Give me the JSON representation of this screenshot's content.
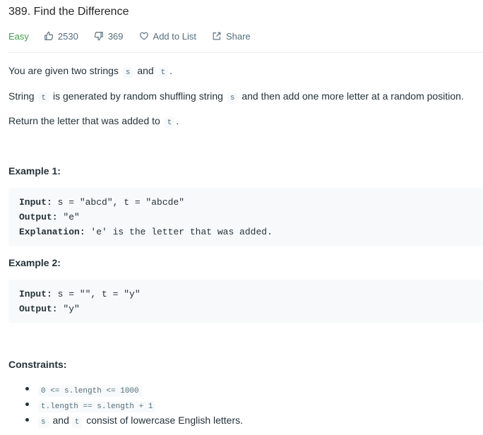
{
  "problem": {
    "title": "389. Find the Difference",
    "difficulty": "Easy",
    "likes": "2530",
    "dislikes": "369",
    "add_to_list": "Add to List",
    "share": "Share"
  },
  "description": {
    "p1": {
      "a": "You are given two strings",
      "s": "s",
      "b": "and",
      "t": "t",
      "c": "."
    },
    "p2": {
      "a": "String",
      "t": "t",
      "b": "is generated by random shuffling string",
      "s": "s",
      "c": "and then add one more letter at a random position."
    },
    "p3": {
      "a": "Return the letter that was added to",
      "t": "t",
      "c": "."
    }
  },
  "examples": [
    {
      "heading": "Example 1:",
      "input_label": "Input:",
      "input": " s = \"abcd\", t = \"abcde\"",
      "output_label": "Output:",
      "output": " \"e\"",
      "explanation_label": "Explanation:",
      "explanation": " 'e' is the letter that was added."
    },
    {
      "heading": "Example 2:",
      "input_label": "Input:",
      "input": " s = \"\", t = \"y\"",
      "output_label": "Output:",
      "output": " \"y\""
    }
  ],
  "constraints": {
    "heading": "Constraints:",
    "c1": "0 <= s.length <= 1000",
    "c2": "t.length == s.length + 1",
    "c3": {
      "s": "s",
      "a": "and",
      "t": "t",
      "b": "consist of lowercase English letters."
    }
  },
  "colors": {
    "easy": "#43a047",
    "meta": "#546e7a",
    "code_bg": "#f7f9fa"
  }
}
